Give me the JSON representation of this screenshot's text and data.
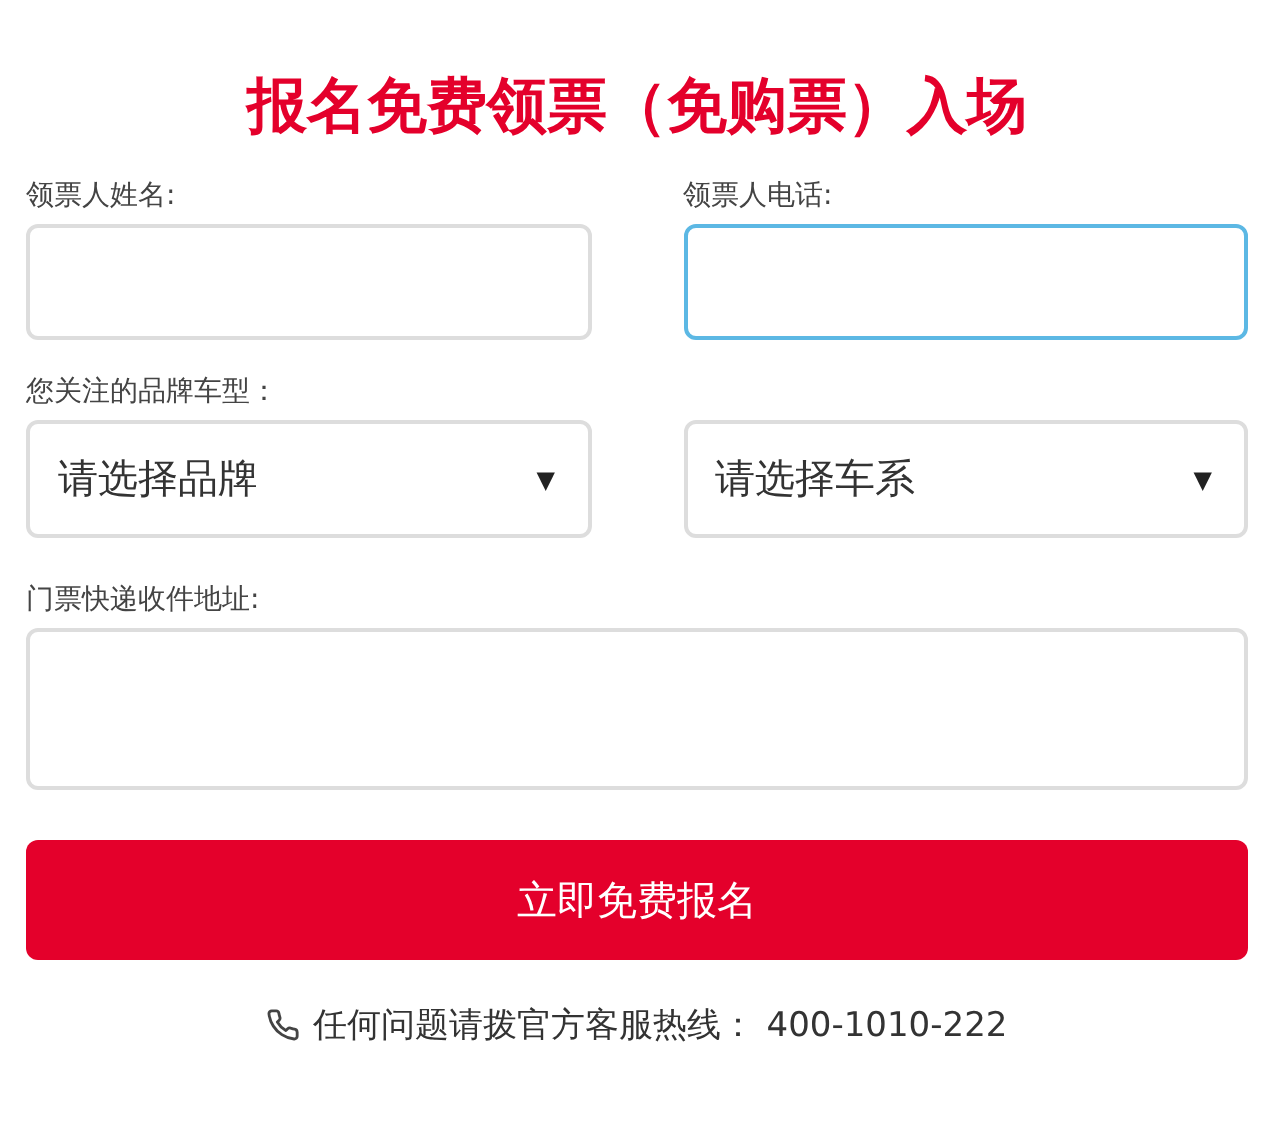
{
  "title": "报名免费领票（免购票）入场",
  "contact_fields": [
    {
      "label": "领票人姓名:",
      "focused": false
    },
    {
      "label": "领票人电话:",
      "focused": true
    }
  ],
  "car_label": "您关注的品牌车型：",
  "selects": [
    {
      "placeholder": "请选择品牌",
      "arrow": "▼"
    },
    {
      "placeholder": "请选择车系",
      "arrow": "▼"
    }
  ],
  "address": {
    "label": "门票快递收件地址:"
  },
  "submit": "立即免费报名",
  "hotline": {
    "text": "任何问题请拨官方客服热线：",
    "number": "400-1010-222"
  }
}
